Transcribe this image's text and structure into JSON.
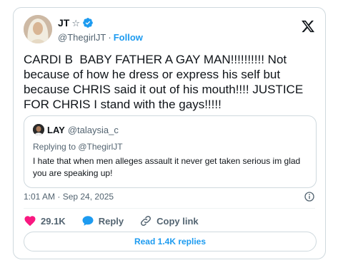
{
  "author": {
    "display_name": "JT",
    "star": "☆",
    "handle": "@ThegirlJT",
    "separator": "·",
    "follow_label": "Follow"
  },
  "tweet": {
    "text": "CARDI B  BABY FATHER A GAY MAN!!!!!!!!!! Not because of how he dress or express his self but because CHRIS said it out of his mouth!!!! JUSTICE FOR CHRIS I stand with the gays!!!!!"
  },
  "quote": {
    "name": "LAY",
    "handle": "@talaysia_c",
    "replying_to": "Replying to @ThegirlJT",
    "text": "I hate that when men alleges assault it never get taken serious im glad you are speaking up!"
  },
  "meta": {
    "timestamp": "1:01 AM · Sep 24, 2025"
  },
  "actions": {
    "likes": "29.1K",
    "reply_label": "Reply",
    "copy_label": "Copy link"
  },
  "replies_button": "Read 1.4K replies",
  "colors": {
    "accent": "#1d9bf0",
    "like": "#f91880",
    "text": "#0f1419",
    "muted": "#536471",
    "border": "#cfd9de"
  },
  "icons": [
    "verified-badge-icon",
    "x-logo-icon",
    "info-icon",
    "heart-icon",
    "reply-bubble-icon",
    "link-icon"
  ]
}
